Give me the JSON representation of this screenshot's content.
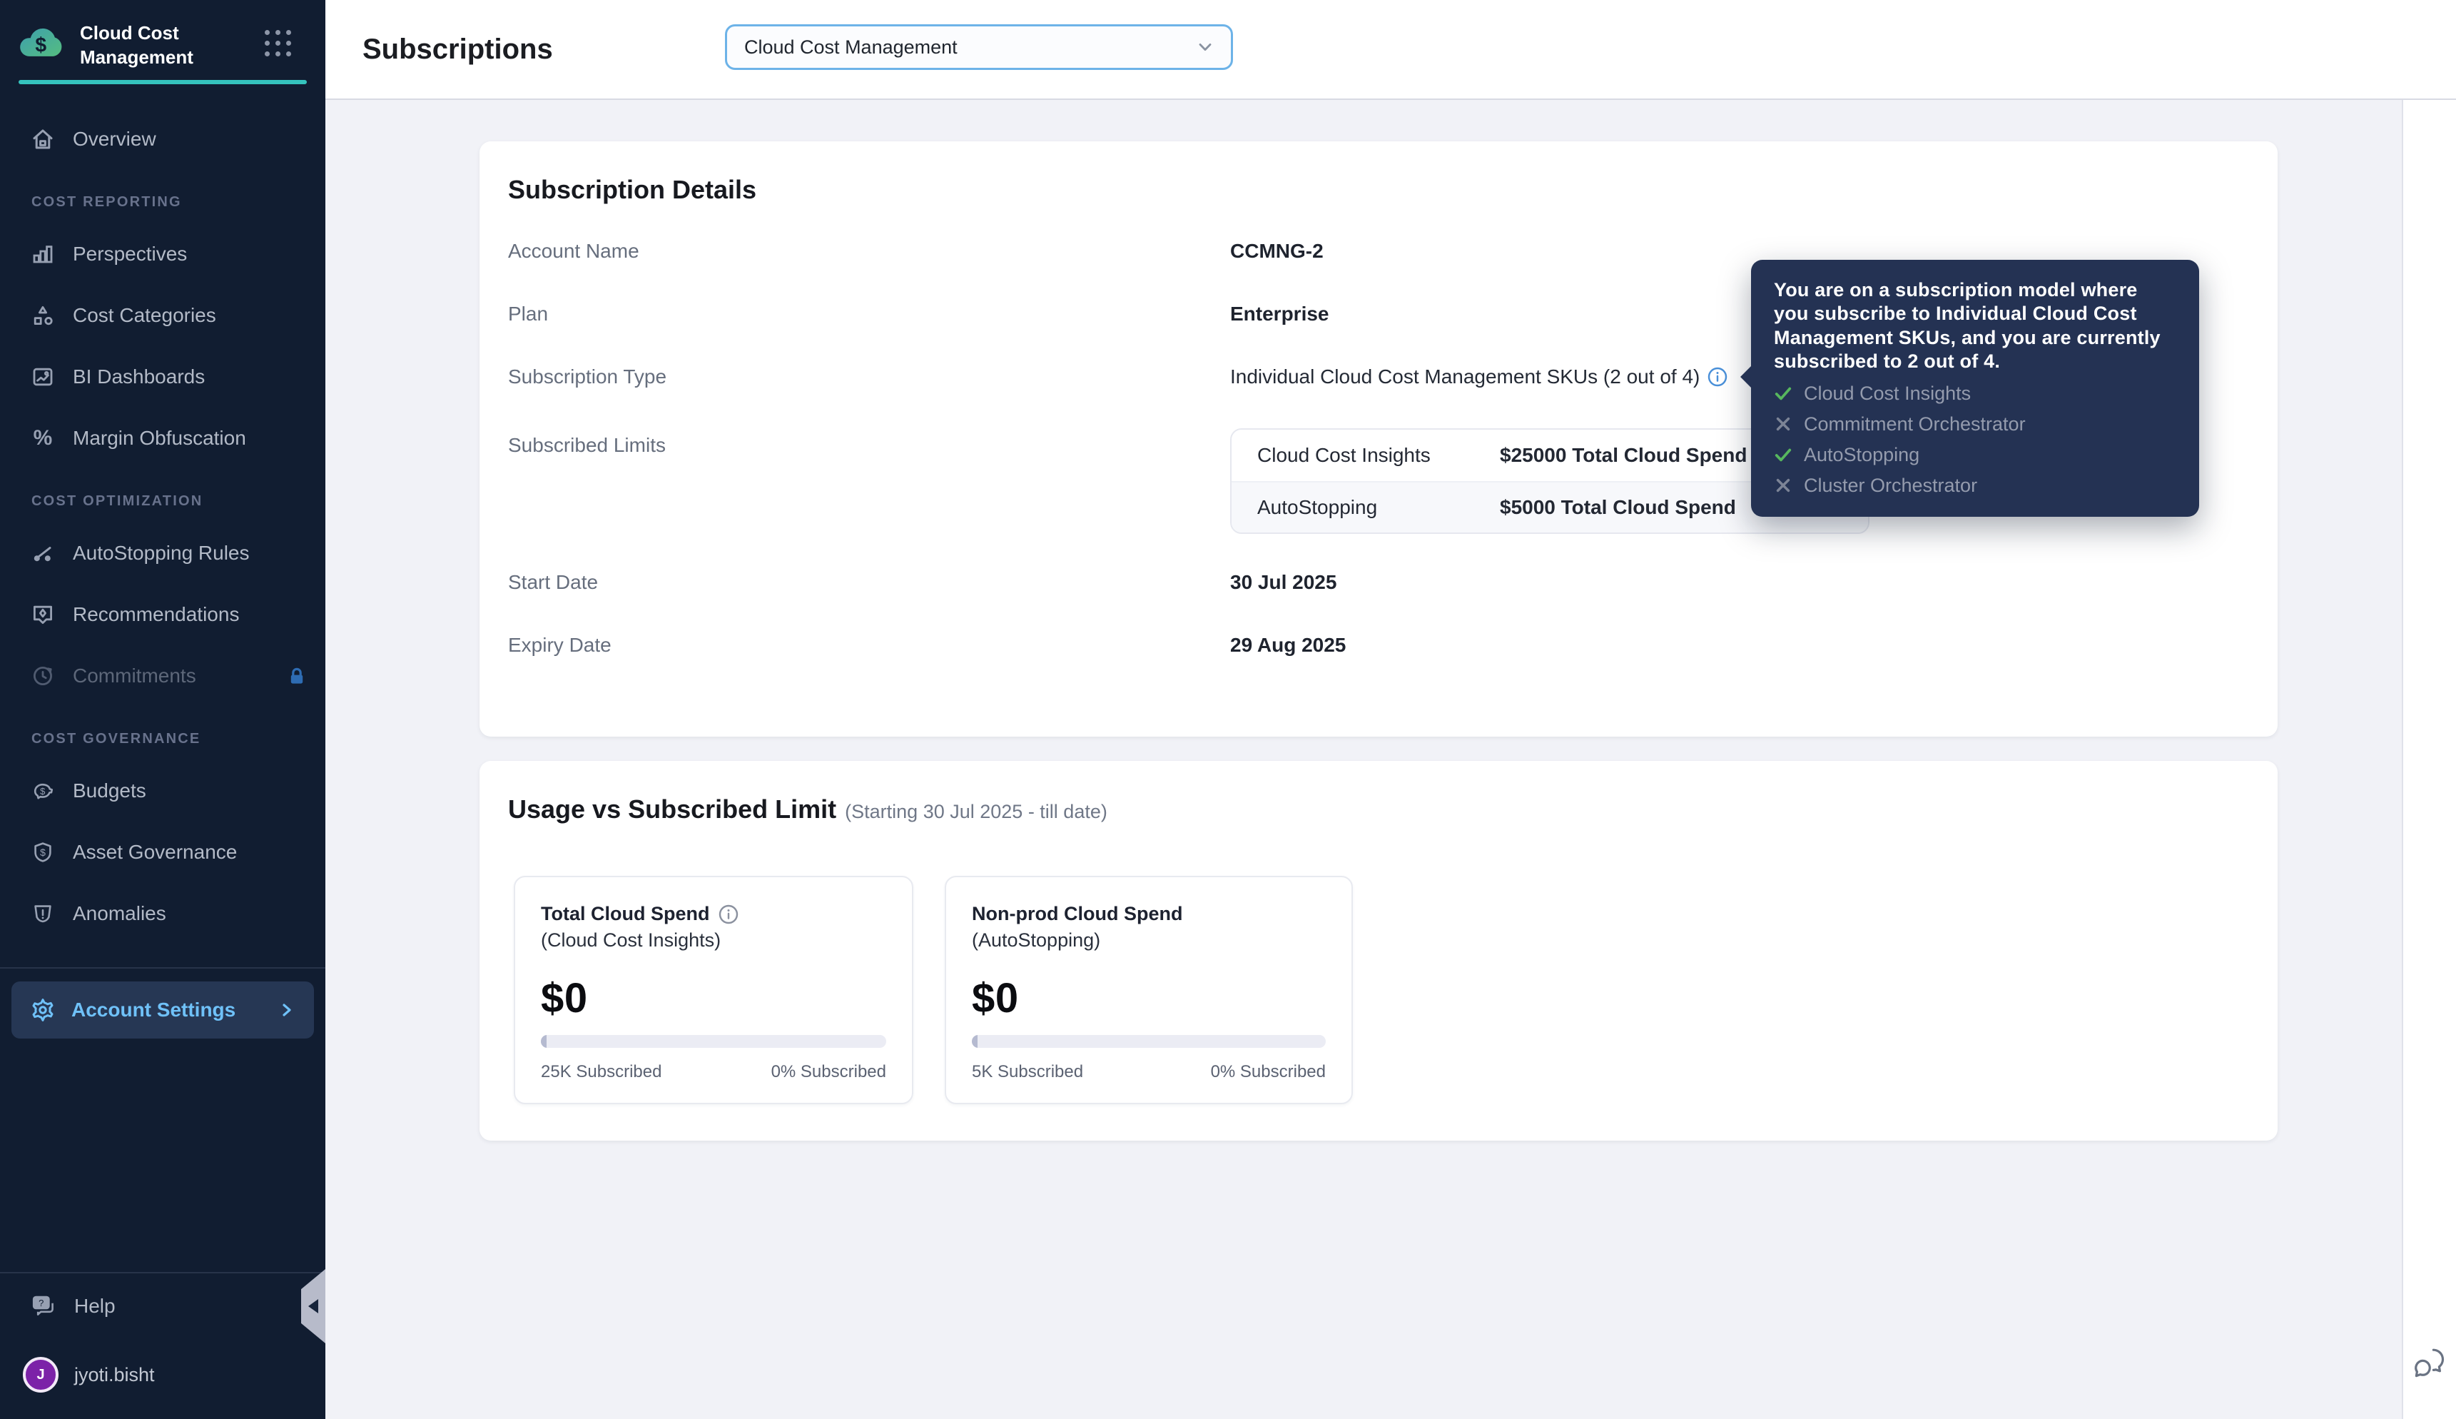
{
  "app": {
    "name": "Cloud Cost Management"
  },
  "sidebar": {
    "overview_label": "Overview",
    "sections": [
      {
        "label": "COST REPORTING",
        "items": [
          {
            "label": "Perspectives"
          },
          {
            "label": "Cost Categories"
          },
          {
            "label": "BI Dashboards"
          },
          {
            "label": "Margin Obfuscation"
          }
        ]
      },
      {
        "label": "COST OPTIMIZATION",
        "items": [
          {
            "label": "AutoStopping Rules"
          },
          {
            "label": "Recommendations"
          },
          {
            "label": "Commitments",
            "locked": true
          }
        ]
      },
      {
        "label": "COST GOVERNANCE",
        "items": [
          {
            "label": "Budgets"
          },
          {
            "label": "Asset Governance"
          },
          {
            "label": "Anomalies"
          }
        ]
      }
    ],
    "account_settings_label": "Account Settings",
    "help_label": "Help",
    "user": {
      "name": "jyoti.bisht",
      "initial": "J"
    }
  },
  "header": {
    "title": "Subscriptions",
    "module_selector_value": "Cloud Cost Management"
  },
  "subscription_details": {
    "title": "Subscription Details",
    "account_name": {
      "label": "Account Name",
      "value": "CCMNG-2"
    },
    "plan": {
      "label": "Plan",
      "value": "Enterprise"
    },
    "subscription_type": {
      "label": "Subscription Type",
      "value": "Individual Cloud Cost Management SKUs (2 out of 4)"
    },
    "subscribed_limits": {
      "label": "Subscribed Limits"
    },
    "start_date": {
      "label": "Start Date",
      "value": "30 Jul 2025"
    },
    "expiry_date": {
      "label": "Expiry Date",
      "value": "29 Aug 2025"
    },
    "limits_table": [
      {
        "sku": "Cloud Cost Insights",
        "limit": "$25000 Total Cloud Spend"
      },
      {
        "sku": "AutoStopping",
        "limit": "$5000 Total Cloud Spend"
      }
    ]
  },
  "tooltip": {
    "text": "You are on a subscription model where you subscribe to Individual Cloud Cost Management SKUs, and you are currently subscribed to 2 out of 4.",
    "items": [
      {
        "label": "Cloud Cost Insights",
        "included": true
      },
      {
        "label": "Commitment Orchestrator",
        "included": false
      },
      {
        "label": "AutoStopping",
        "included": true
      },
      {
        "label": "Cluster Orchestrator",
        "included": false
      }
    ]
  },
  "usage": {
    "title": "Usage vs Subscribed Limit",
    "subtitle": "(Starting 30 Jul 2025 - till date)",
    "cards": [
      {
        "title": "Total Cloud Spend",
        "subtitle": "(Cloud Cost Insights)",
        "amount": "$0",
        "subscribed": "25K Subscribed",
        "percent": "0% Subscribed"
      },
      {
        "title": "Non-prod Cloud Spend",
        "subtitle": "(AutoStopping)",
        "amount": "$0",
        "subscribed": "5K Subscribed",
        "percent": "0% Subscribed"
      }
    ]
  },
  "colors": {
    "sidebar_bg": "#111d31",
    "teal_accent": "#35c3bd",
    "accent_blue": "#6fc1f8",
    "lock_blue": "#2e6cb3",
    "tooltip_bg": "#243253",
    "green_check": "#57b75e",
    "gray_cross": "#7c8496",
    "avatar_purple": "#7c22a8",
    "content_bg": "#f1f2f7",
    "select_border": "#6db3e8"
  }
}
